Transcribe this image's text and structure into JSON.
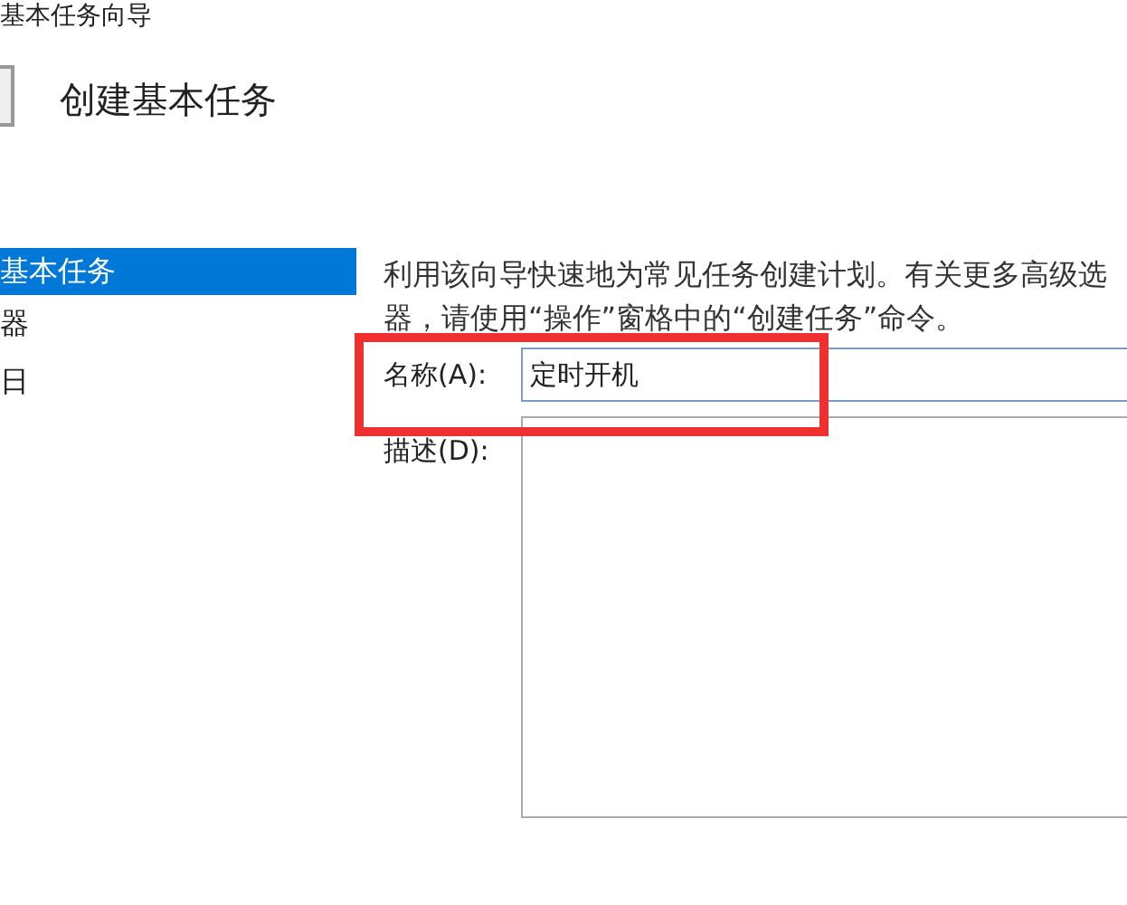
{
  "window": {
    "title": "基本任务向导"
  },
  "header": {
    "title": "创建基本任务"
  },
  "steps": [
    {
      "label": "基本任务",
      "selected": true
    },
    {
      "label": "器",
      "selected": false
    },
    {
      "label": "日",
      "selected": false
    }
  ],
  "intro_lines": [
    "利用该向导快速地为常见任务创建计划。有关更多高级选",
    "器，请使用“操作”窗格中的“创建任务”命令。"
  ],
  "name_field": {
    "label": "名称(A):",
    "value": "定时开机"
  },
  "description_field": {
    "label": "描述(D):"
  }
}
